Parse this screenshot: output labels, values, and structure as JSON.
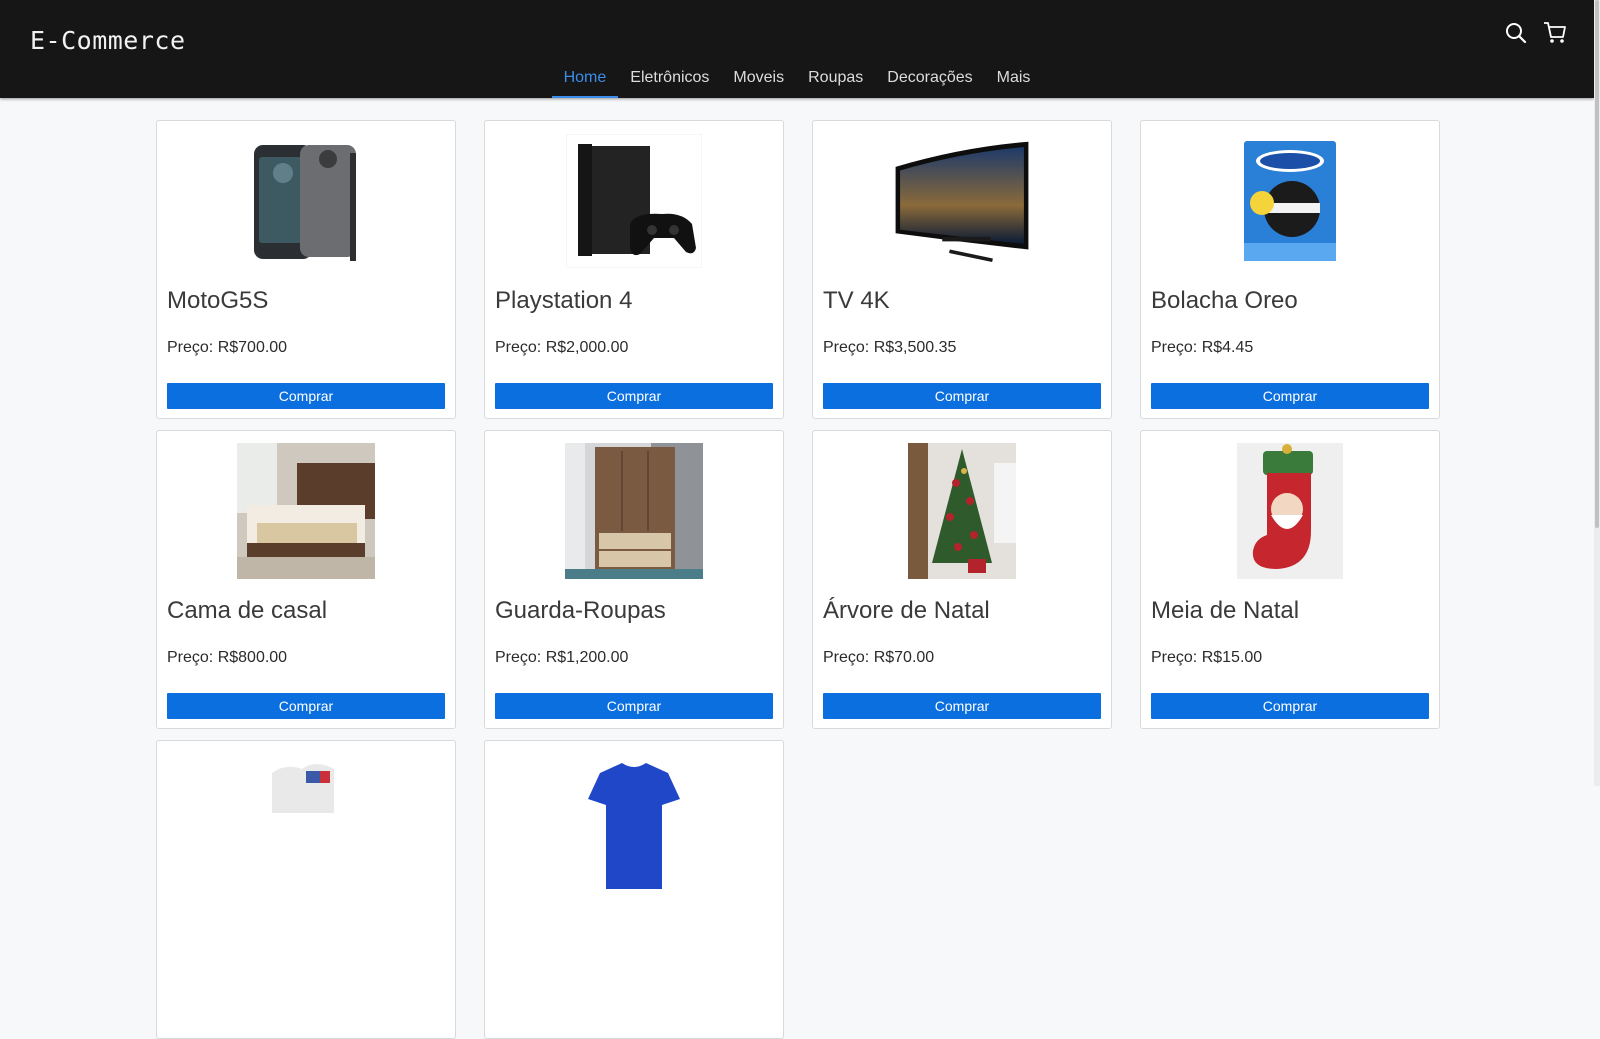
{
  "header": {
    "brand": "E-Commerce",
    "search_icon": "search-icon",
    "cart_icon": "cart-icon"
  },
  "nav": {
    "items": [
      {
        "label": "Home",
        "active": true
      },
      {
        "label": "Eletrônicos",
        "active": false
      },
      {
        "label": "Moveis",
        "active": false
      },
      {
        "label": "Roupas",
        "active": false
      },
      {
        "label": "Decorações",
        "active": false
      },
      {
        "label": "Mais",
        "active": false
      }
    ]
  },
  "colors": {
    "header_bg": "#161616",
    "accent": "#3b8dea",
    "button": "#0b6fe0"
  },
  "products": [
    {
      "name": "MotoG5S",
      "price": "Preço: R$700.00",
      "button": "Comprar",
      "image": "phone"
    },
    {
      "name": "Playstation 4",
      "price": "Preço: R$2,000.00",
      "button": "Comprar",
      "image": "console"
    },
    {
      "name": "TV 4K",
      "price": "Preço: R$3,500.35",
      "button": "Comprar",
      "image": "tv"
    },
    {
      "name": "Bolacha Oreo",
      "price": "Preço: R$4.45",
      "button": "Comprar",
      "image": "cookie-box"
    },
    {
      "name": "Cama de casal",
      "price": "Preço: R$800.00",
      "button": "Comprar",
      "image": "bed"
    },
    {
      "name": "Guarda-Roupas",
      "price": "Preço: R$1,200.00",
      "button": "Comprar",
      "image": "wardrobe"
    },
    {
      "name": "Árvore de Natal",
      "price": "Preço: R$70.00",
      "button": "Comprar",
      "image": "christmas-tree"
    },
    {
      "name": "Meia de Natal",
      "price": "Preço: R$15.00",
      "button": "Comprar",
      "image": "christmas-stocking"
    },
    {
      "name": "",
      "price": "",
      "button": "",
      "image": "mug"
    },
    {
      "name": "",
      "price": "",
      "button": "",
      "image": "shirt"
    }
  ]
}
